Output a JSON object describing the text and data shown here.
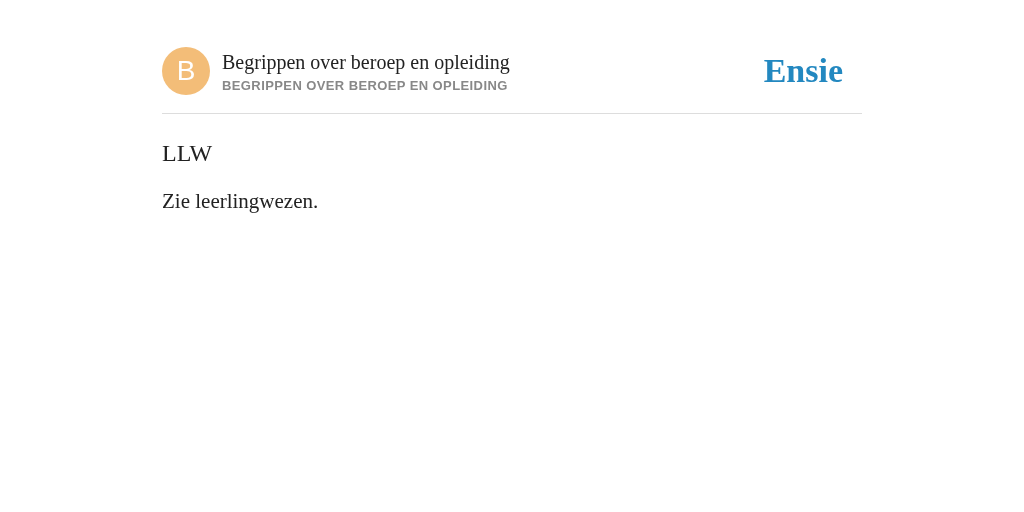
{
  "header": {
    "avatar_letter": "B",
    "title": "Begrippen over beroep en opleiding",
    "subtitle": "BEGRIPPEN OVER BEROEP EN OPLEIDING",
    "logo": "Ensie"
  },
  "entry": {
    "term": "LLW",
    "definition": "Zie leerlingwezen."
  }
}
